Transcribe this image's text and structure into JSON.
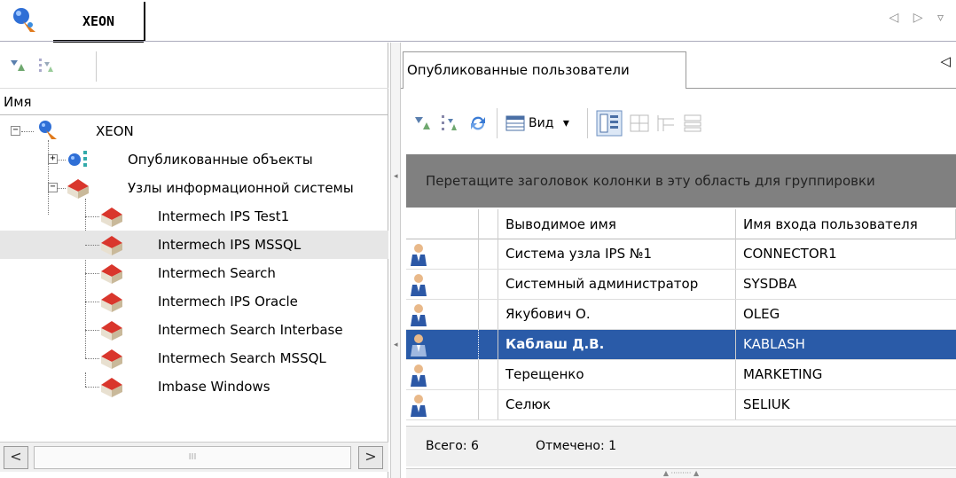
{
  "top": {
    "tab_label": "XEON",
    "nav_glyphs": "◁ ▷ ▿"
  },
  "left": {
    "column_header": "Имя",
    "tree": [
      {
        "label": "XEON",
        "level": 0,
        "expander": "−",
        "icon": "server-node-icon"
      },
      {
        "label": "Опубликованные объекты",
        "level": 1,
        "expander": "+",
        "icon": "published-objects-icon"
      },
      {
        "label": "Узлы информационной системы",
        "level": 1,
        "expander": "−",
        "icon": "node-house-icon"
      },
      {
        "label": "Intermech IPS Test1",
        "level": 2,
        "icon": "node-house-icon"
      },
      {
        "label": "Intermech IPS MSSQL",
        "level": 2,
        "icon": "node-house-icon",
        "selected": true
      },
      {
        "label": "Intermech Search",
        "level": 2,
        "icon": "node-house-icon"
      },
      {
        "label": "Intermech IPS Oracle",
        "level": 2,
        "icon": "node-house-icon"
      },
      {
        "label": "Intermech Search Interbase",
        "level": 2,
        "icon": "node-house-icon"
      },
      {
        "label": "Intermech Search MSSQL",
        "level": 2,
        "icon": "node-house-icon"
      },
      {
        "label": "Imbase Windows",
        "level": 2,
        "icon": "node-house-icon"
      }
    ],
    "scroll_left": "<",
    "scroll_right": ">",
    "scroll_thumb": "III"
  },
  "right": {
    "tab_label": "Опубликованные пользователи",
    "tab_arrow": "◁",
    "view_button": "Вид",
    "view_arrow": "▾",
    "group_hint": "Перетащите заголовок колонки в эту область для группировки",
    "columns": [
      "Выводимое имя",
      "Имя входа пользователя"
    ],
    "rows": [
      {
        "display_name": "Система узла IPS №1",
        "login": "CONNECTOR1"
      },
      {
        "display_name": "Системный администратор",
        "login": "SYSDBA"
      },
      {
        "display_name": "Якубович О.",
        "login": "OLEG"
      },
      {
        "display_name": "Каблаш Д.В.",
        "login": "KABLASH",
        "selected": true
      },
      {
        "display_name": "Терещенко",
        "login": "MARKETING"
      },
      {
        "display_name": "Селюк",
        "login": "SELIUK"
      }
    ],
    "status_total": "Всего: 6",
    "status_marked": "Отмечено: 1"
  },
  "colors": {
    "selection": "#2a5ba8",
    "group_area": "#808080"
  }
}
